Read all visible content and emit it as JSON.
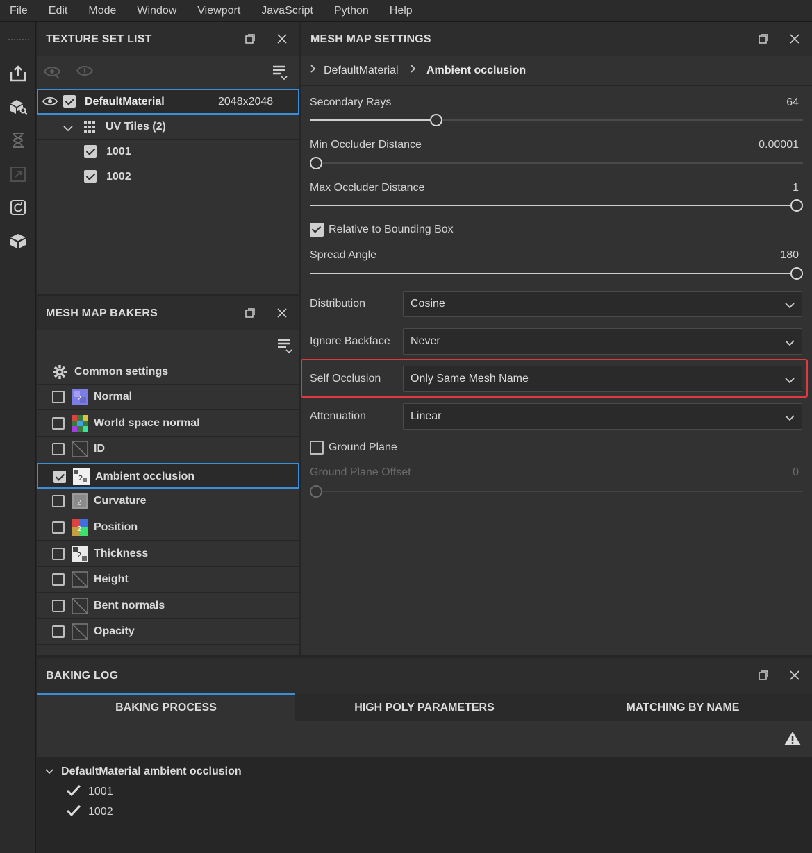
{
  "menu": [
    "File",
    "Edit",
    "Mode",
    "Window",
    "Viewport",
    "JavaScript",
    "Python",
    "Help"
  ],
  "texture_set_list": {
    "title": "TEXTURE SET LIST",
    "material": {
      "name": "DefaultMaterial",
      "resolution": "2048x2048",
      "checked": true
    },
    "uv_tiles_label": "UV Tiles (2)",
    "tiles": [
      {
        "name": "1001",
        "checked": true
      },
      {
        "name": "1002",
        "checked": true
      }
    ]
  },
  "mesh_map_bakers": {
    "title": "MESH MAP BAKERS",
    "common_settings": "Common settings",
    "items": [
      {
        "label": "Normal",
        "checked": false,
        "thumb": "normal-map-thumb"
      },
      {
        "label": "World space normal",
        "checked": false,
        "thumb": "world-space-normal-thumb"
      },
      {
        "label": "ID",
        "checked": false,
        "thumb": "empty-thumb"
      },
      {
        "label": "Ambient occlusion",
        "checked": true,
        "thumb": "ambient-occlusion-thumb",
        "selected": true
      },
      {
        "label": "Curvature",
        "checked": false,
        "thumb": "curvature-thumb"
      },
      {
        "label": "Position",
        "checked": false,
        "thumb": "position-thumb"
      },
      {
        "label": "Thickness",
        "checked": false,
        "thumb": "thickness-thumb"
      },
      {
        "label": "Height",
        "checked": false,
        "thumb": "empty-thumb"
      },
      {
        "label": "Bent normals",
        "checked": false,
        "thumb": "empty-thumb"
      },
      {
        "label": "Opacity",
        "checked": false,
        "thumb": "empty-thumb"
      }
    ]
  },
  "mesh_map_settings": {
    "title": "MESH MAP SETTINGS",
    "breadcrumb": [
      "DefaultMaterial",
      "Ambient occlusion"
    ],
    "secondary_rays": {
      "label": "Secondary Rays",
      "value": "64",
      "fraction": 0.25
    },
    "min_occluder": {
      "label": "Min Occluder Distance",
      "value": "0.00001",
      "fraction": 0.0
    },
    "max_occluder": {
      "label": "Max Occluder Distance",
      "value": "1",
      "fraction": 1.0
    },
    "relative_bbox": {
      "label": "Relative to Bounding Box",
      "checked": true
    },
    "spread_angle": {
      "label": "Spread Angle",
      "value": "180",
      "fraction": 1.0
    },
    "distribution": {
      "label": "Distribution",
      "value": "Cosine"
    },
    "ignore_backface": {
      "label": "Ignore Backface",
      "value": "Never"
    },
    "self_occlusion": {
      "label": "Self Occlusion",
      "value": "Only Same Mesh Name"
    },
    "attenuation": {
      "label": "Attenuation",
      "value": "Linear"
    },
    "ground_plane": {
      "label": "Ground Plane",
      "checked": false
    },
    "ground_plane_offset": {
      "label": "Ground Plane Offset",
      "value": "0",
      "fraction": 0.0
    },
    "highlight_color": "#e0393e"
  },
  "baking_log": {
    "title": "BAKING LOG",
    "tabs": [
      "BAKING PROCESS",
      "HIGH POLY PARAMETERS",
      "MATCHING BY NAME"
    ],
    "active_tab": 0,
    "entry": "DefaultMaterial ambient occlusion",
    "items": [
      "1001",
      "1002"
    ]
  },
  "colors": {
    "accent": "#3a8fd8"
  }
}
